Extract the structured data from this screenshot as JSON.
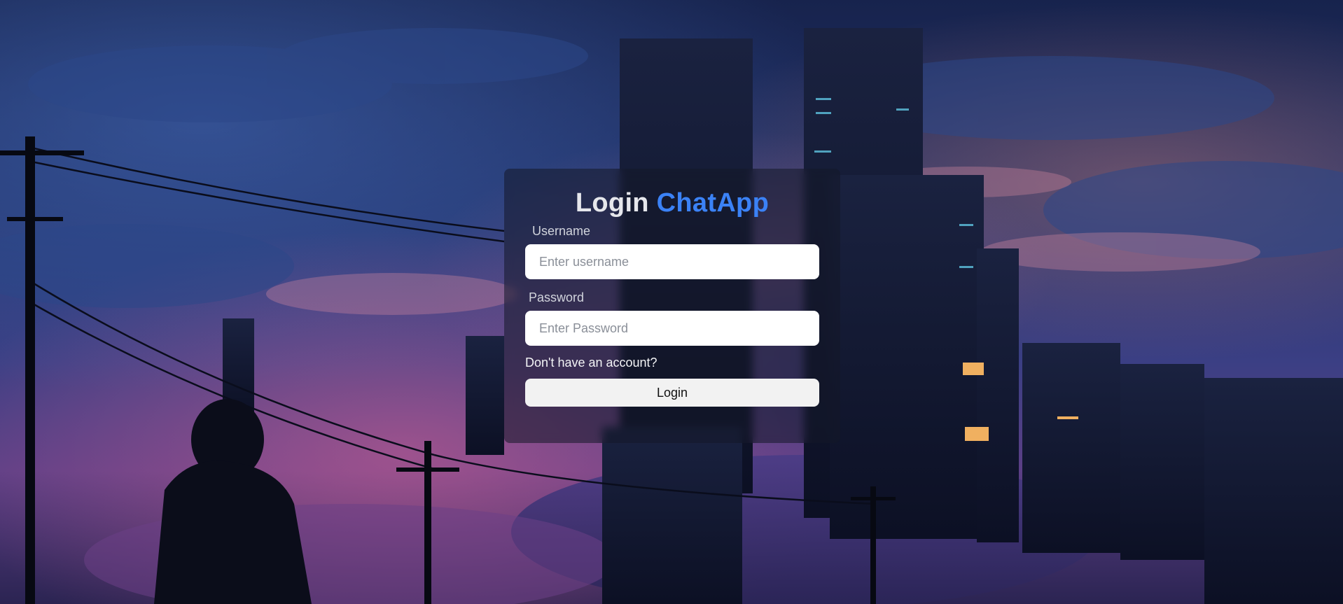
{
  "page": {
    "background_scene": "night-city-clouds-illustration"
  },
  "login": {
    "title_prefix": "Login",
    "title_brand": "ChatApp",
    "brand_color": "#3b82f6",
    "username": {
      "label": "Username",
      "placeholder": "Enter username",
      "value": ""
    },
    "password": {
      "label": "Password",
      "placeholder": "Enter Password",
      "value": ""
    },
    "signup_link": "Don't have an account?",
    "submit_label": "Login"
  }
}
